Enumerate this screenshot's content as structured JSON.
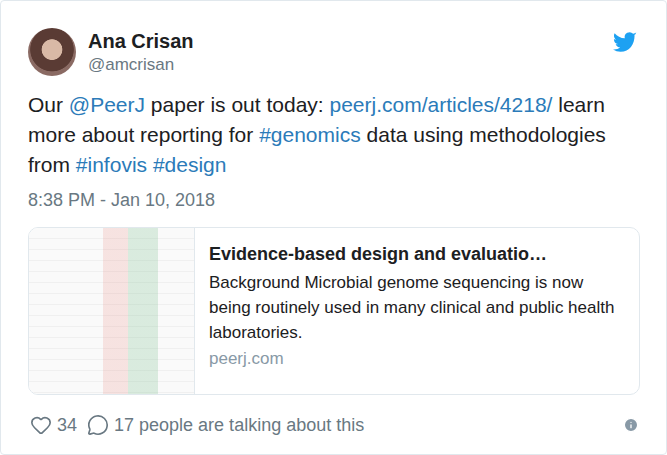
{
  "author": {
    "name": "Ana Crisan",
    "handle": "@amcrisan"
  },
  "tweet": {
    "segments": [
      {
        "text": "Our ",
        "kind": "plain"
      },
      {
        "text": "@PeerJ",
        "kind": "link"
      },
      {
        "text": " paper is out today: ",
        "kind": "plain"
      },
      {
        "text": "peerj.com/articles/4218/",
        "kind": "link"
      },
      {
        "text": " learn more about reporting for ",
        "kind": "plain"
      },
      {
        "text": "#genomics",
        "kind": "link"
      },
      {
        "text": " data using methodologies from ",
        "kind": "plain"
      },
      {
        "text": "#infovis",
        "kind": "link"
      },
      {
        "text": " ",
        "kind": "plain"
      },
      {
        "text": "#design",
        "kind": "link"
      }
    ],
    "time": "8:38 PM - Jan 10, 2018"
  },
  "card": {
    "title": "Evidence-based design and evaluatio…",
    "description": "Background Microbial genome sequencing is now being routinely used in many clinical and public health laboratories.",
    "domain": "peerj.com"
  },
  "footer": {
    "likes": "34",
    "talking": "17 people are talking about this"
  }
}
